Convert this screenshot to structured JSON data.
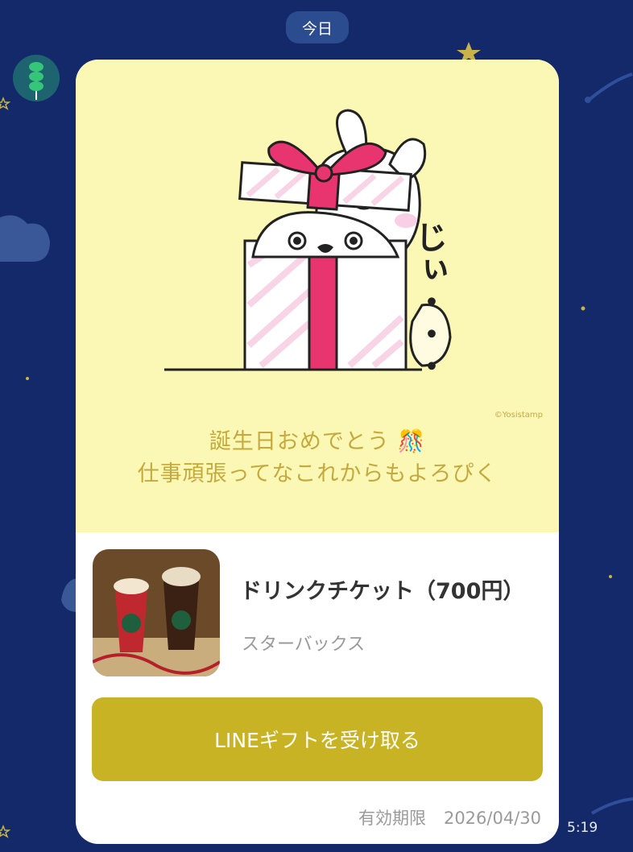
{
  "header": {
    "date_label": "今日"
  },
  "chat": {
    "time": "5:19"
  },
  "card": {
    "copyright": "©Yosistamp",
    "sticker_text": "じぃ・・・",
    "message_line1": "誕生日おめでとう",
    "message_line2": "仕事頑張ってなこれからもよろぴく",
    "product": {
      "name": "ドリンクチケット（700円）",
      "brand": "スターバックス"
    },
    "receive_button": "LINEギフトを受け取る",
    "expiry_label": "有効期限",
    "expiry_date": "2026/04/30"
  },
  "colors": {
    "background": "#13296a",
    "card_top": "#fbf7b4",
    "button": "#c8b324",
    "message_text": "#c5a93f",
    "gift_ribbon": "#e8356f"
  }
}
